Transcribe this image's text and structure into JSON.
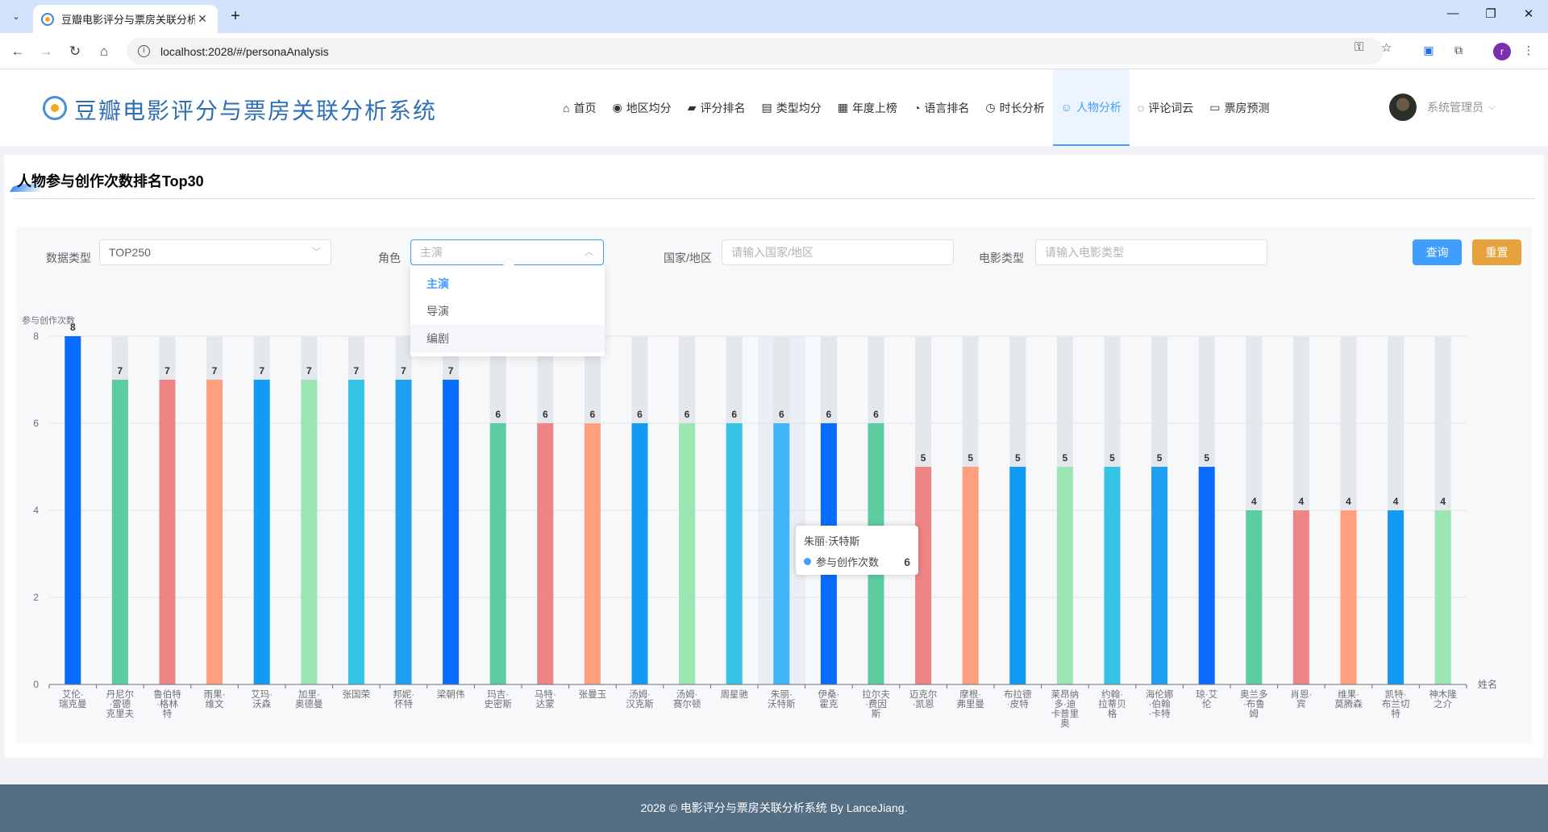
{
  "browser": {
    "tab_title": "豆瓣电影评分与票房关联分析系",
    "url": "localhost:2028/#/personaAnalysis",
    "profile_initial": "r"
  },
  "header": {
    "app_title": "豆瓣电影评分与票房关联分析系统",
    "nav": [
      {
        "label": "首页",
        "icon": "home-icon",
        "glyph": "⌂"
      },
      {
        "label": "地区均分",
        "icon": "location-icon",
        "glyph": "◉"
      },
      {
        "label": "评分排名",
        "icon": "trend-chart-icon",
        "glyph": "▰"
      },
      {
        "label": "类型均分",
        "icon": "notebook-icon",
        "glyph": "▤"
      },
      {
        "label": "年度上榜",
        "icon": "calendar-icon",
        "glyph": "▦"
      },
      {
        "label": "语言排名",
        "icon": "chat-icon",
        "glyph": "◔"
      },
      {
        "label": "时长分析",
        "icon": "timer-icon",
        "glyph": "◷"
      },
      {
        "label": "人物分析",
        "icon": "user-icon",
        "glyph": "☺"
      },
      {
        "label": "评论词云",
        "icon": "chat-dot-icon",
        "glyph": "◌"
      },
      {
        "label": "票房预测",
        "icon": "tickets-icon",
        "glyph": "▭"
      }
    ],
    "active_nav": "人物分析",
    "user_name": "系统管理员"
  },
  "page": {
    "title": "人物参与创作次数排名Top30"
  },
  "filters": {
    "data_type_label": "数据类型",
    "data_type_value": "TOP250",
    "role_label": "角色",
    "role_placeholder": "主演",
    "country_label": "国家/地区",
    "country_placeholder": "请输入国家/地区",
    "genre_label": "电影类型",
    "genre_placeholder": "请输入电影类型",
    "query_button": "查询",
    "reset_button": "重置",
    "role_options": [
      "主演",
      "导演",
      "编剧"
    ],
    "role_selected": "主演",
    "role_hovered": "编剧"
  },
  "tooltip": {
    "name": "朱丽·沃特斯",
    "series": "参与创作次数",
    "value": "6",
    "color": "#409eff"
  },
  "chart_data": {
    "type": "bar",
    "ylabel": "参与创作次数",
    "xlabel": "姓名",
    "ylim": [
      0,
      8
    ],
    "yticks": [
      0,
      2,
      4,
      6,
      8
    ],
    "grid": true,
    "background_bars": true,
    "categories": [
      "艾伦·瑞克曼",
      "丹尼尔·雷德克里夫",
      "鲁伯特·格林特",
      "雨果·维文",
      "艾玛·沃森",
      "加里·奥德曼",
      "张国荣",
      "邦妮·怀特",
      "梁朝伟",
      "玛吉·史密斯",
      "马特·达蒙",
      "张曼玉",
      "汤姆·汉克斯",
      "汤姆·赛尔顿",
      "周星驰",
      "朱丽·沃特斯",
      "伊桑·霍克",
      "拉尔夫·费因斯",
      "迈克尔·凯恩",
      "摩根·弗里曼",
      "布拉德·皮特",
      "莱昂纳多·迪卡普里奥",
      "约翰·拉蒂贝格",
      "海伦娜·伯翰·卡特",
      "琼·艾伦",
      "奥兰多·布鲁姆",
      "肖恩·宾",
      "维果·莫腾森",
      "凯特·布兰切特",
      "神木隆之介"
    ],
    "category_lines": [
      [
        "艾伦·",
        "瑞克曼"
      ],
      [
        "丹尼尔",
        "·雷德",
        "克里夫"
      ],
      [
        "鲁伯特",
        "·格林",
        "特"
      ],
      [
        "雨果·",
        "维文"
      ],
      [
        "艾玛·",
        "沃森"
      ],
      [
        "加里·",
        "奥德曼"
      ],
      [
        "张国荣"
      ],
      [
        "邦妮·",
        "怀特"
      ],
      [
        "梁朝伟"
      ],
      [
        "玛吉·",
        "史密斯"
      ],
      [
        "马特·",
        "达蒙"
      ],
      [
        "张曼玉"
      ],
      [
        "汤姆·",
        "汉克斯"
      ],
      [
        "汤姆·",
        "赛尔顿"
      ],
      [
        "周星驰"
      ],
      [
        "朱丽·",
        "沃特斯"
      ],
      [
        "伊桑·",
        "霍克"
      ],
      [
        "拉尔夫",
        "·费因",
        "斯"
      ],
      [
        "迈克尔",
        "·凯恩"
      ],
      [
        "摩根·",
        "弗里曼"
      ],
      [
        "布拉德",
        "·皮特"
      ],
      [
        "莱昂纳",
        "多·迪",
        "卡普里",
        "奥"
      ],
      [
        "约翰·",
        "拉蒂贝",
        "格"
      ],
      [
        "海伦娜",
        "·伯翰",
        "·卡特"
      ],
      [
        "琼·艾",
        "伦"
      ],
      [
        "奥兰多",
        "·布鲁",
        "姆"
      ],
      [
        "肖恩·",
        "宾"
      ],
      [
        "维果·",
        "莫腾森"
      ],
      [
        "凯特·",
        "布兰切",
        "特"
      ],
      [
        "神木隆",
        "之介"
      ]
    ],
    "values": [
      8,
      7,
      7,
      7,
      7,
      7,
      7,
      7,
      7,
      6,
      6,
      6,
      6,
      6,
      6,
      6,
      6,
      6,
      5,
      5,
      5,
      5,
      5,
      5,
      5,
      4,
      4,
      4,
      4,
      4
    ],
    "bar_colors": [
      "#0a6cff",
      "#5ccda0",
      "#ee8484",
      "#ff9f7f",
      "#129bf5",
      "#9ce6b4",
      "#35c3e6",
      "#1f9ff0",
      "#0a6cff",
      "#5ccda0",
      "#ee8484",
      "#ff9f7f",
      "#129bf5",
      "#9ce6b4",
      "#35c3e6",
      "#40b6f8",
      "#0a6cff",
      "#5ccda0",
      "#ee8484",
      "#ff9f7f",
      "#129bf5",
      "#9ce6b4",
      "#35c3e6",
      "#1f9ff0",
      "#0a6cff",
      "#5ccda0",
      "#ee8484",
      "#ff9f7f",
      "#129bf5",
      "#9ce6b4"
    ],
    "highlighted_index": 15
  },
  "footer": {
    "text": "2028 © 电影评分与票房关联分析系统 By LanceJiang."
  }
}
